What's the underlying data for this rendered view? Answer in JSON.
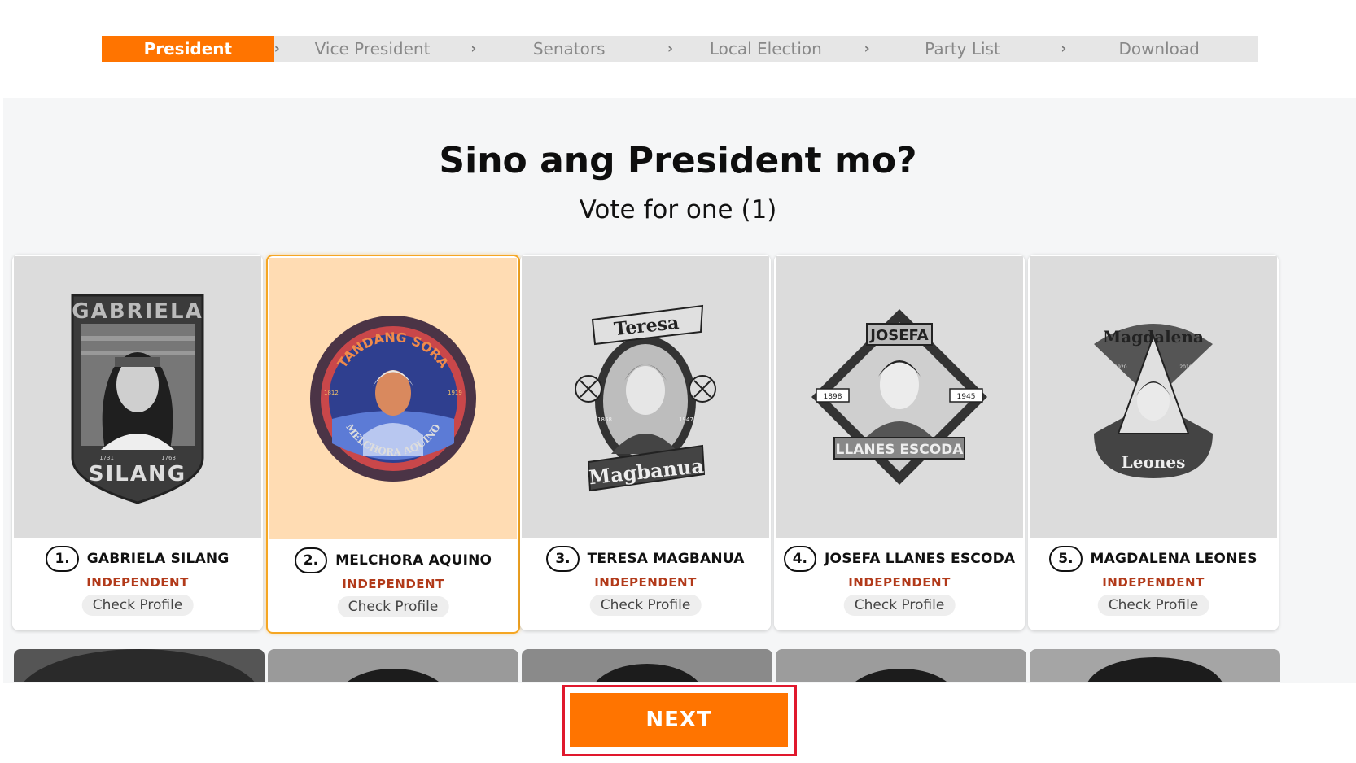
{
  "steps": [
    {
      "label": "President",
      "active": true
    },
    {
      "label": "Vice President",
      "active": false
    },
    {
      "label": "Senators",
      "active": false
    },
    {
      "label": "Local Election",
      "active": false
    },
    {
      "label": "Party List",
      "active": false
    },
    {
      "label": "Download",
      "active": false
    }
  ],
  "step_separator": "›",
  "heading": {
    "question": "Sino ang President mo?",
    "subtitle": "Vote for one (1)"
  },
  "candidates": [
    {
      "number": "1.",
      "name": "GABRIELA SILANG",
      "party": "INDEPENDENT",
      "profile_label": "Check Profile",
      "selected": false,
      "art": {
        "top": "GABRIELA",
        "bottom": "SILANG",
        "years": [
          "1731",
          "1763"
        ]
      }
    },
    {
      "number": "2.",
      "name": "MELCHORA AQUINO",
      "party": "INDEPENDENT",
      "profile_label": "Check Profile",
      "selected": true,
      "art": {
        "top": "TANDANG SORA",
        "bottom": "MELCHORA AQUINO",
        "years": [
          "1812",
          "1919"
        ]
      }
    },
    {
      "number": "3.",
      "name": "TERESA MAGBANUA",
      "party": "INDEPENDENT",
      "profile_label": "Check Profile",
      "selected": false,
      "art": {
        "top": "Teresa",
        "bottom": "Magbanua",
        "years": [
          "1868",
          "1947"
        ]
      }
    },
    {
      "number": "4.",
      "name": "JOSEFA LLANES ESCODA",
      "party": "INDEPENDENT",
      "profile_label": "Check Profile",
      "selected": false,
      "art": {
        "top": "JOSEFA",
        "bottom": "LLANES ESCODA",
        "years": [
          "1898",
          "1945"
        ]
      }
    },
    {
      "number": "5.",
      "name": "MAGDALENA LEONES",
      "party": "INDEPENDENT",
      "profile_label": "Check Profile",
      "selected": false,
      "art": {
        "top": "Magdalena",
        "bottom": "Leones",
        "years": [
          "1920",
          "2016"
        ]
      }
    }
  ],
  "next_label": "NEXT",
  "colors": {
    "accent": "#ff7400",
    "party": "#b23a1a",
    "selected_bg": "#ffdcb3",
    "highlight": "#e0182d"
  }
}
